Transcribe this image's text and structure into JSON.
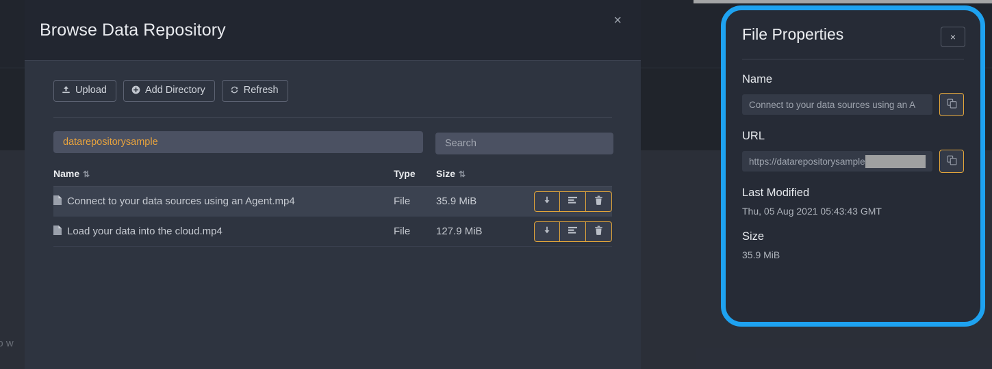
{
  "background": {
    "partial_text": "no w"
  },
  "browse_modal": {
    "title": "Browse Data Repository",
    "close_label": "×",
    "toolbar": {
      "upload_label": "Upload",
      "upload_icon": "upload-icon",
      "add_directory_label": "Add Directory",
      "add_directory_icon": "plus-circle-icon",
      "refresh_label": "Refresh",
      "refresh_icon": "refresh-icon"
    },
    "path_value": "datarepositorysample",
    "search_placeholder": "Search",
    "search_value": "",
    "table": {
      "columns": [
        {
          "key": "name",
          "label": "Name",
          "sortable": true
        },
        {
          "key": "type",
          "label": "Type",
          "sortable": false
        },
        {
          "key": "size",
          "label": "Size",
          "sortable": true
        },
        {
          "key": "actions",
          "label": "",
          "sortable": false
        }
      ],
      "sort_glyph": "⇅",
      "rows": [
        {
          "icon": "file-icon",
          "name": "Connect to your data sources using an Agent.mp4",
          "type": "File",
          "size": "35.9 MiB",
          "selected": true,
          "actions": [
            "download-icon",
            "properties-icon",
            "trash-icon"
          ]
        },
        {
          "icon": "file-icon",
          "name": "Load your data into the cloud.mp4",
          "type": "File",
          "size": "127.9 MiB",
          "selected": false,
          "actions": [
            "download-icon",
            "properties-icon",
            "trash-icon"
          ]
        }
      ]
    }
  },
  "file_properties": {
    "title": "File Properties",
    "close_label": "×",
    "highlight_color": "#1ea2f0",
    "accent_color": "#e2a53a",
    "fields": {
      "name_label": "Name",
      "name_value": "Connect to your data sources using an A",
      "url_label": "URL",
      "url_value": "https://datarepositorysample",
      "url_redacted": true,
      "last_modified_label": "Last Modified",
      "last_modified_value": "Thu, 05 Aug 2021 05:43:43 GMT",
      "size_label": "Size",
      "size_value": "35.9 MiB"
    },
    "copy_icon": "copy-icon"
  }
}
